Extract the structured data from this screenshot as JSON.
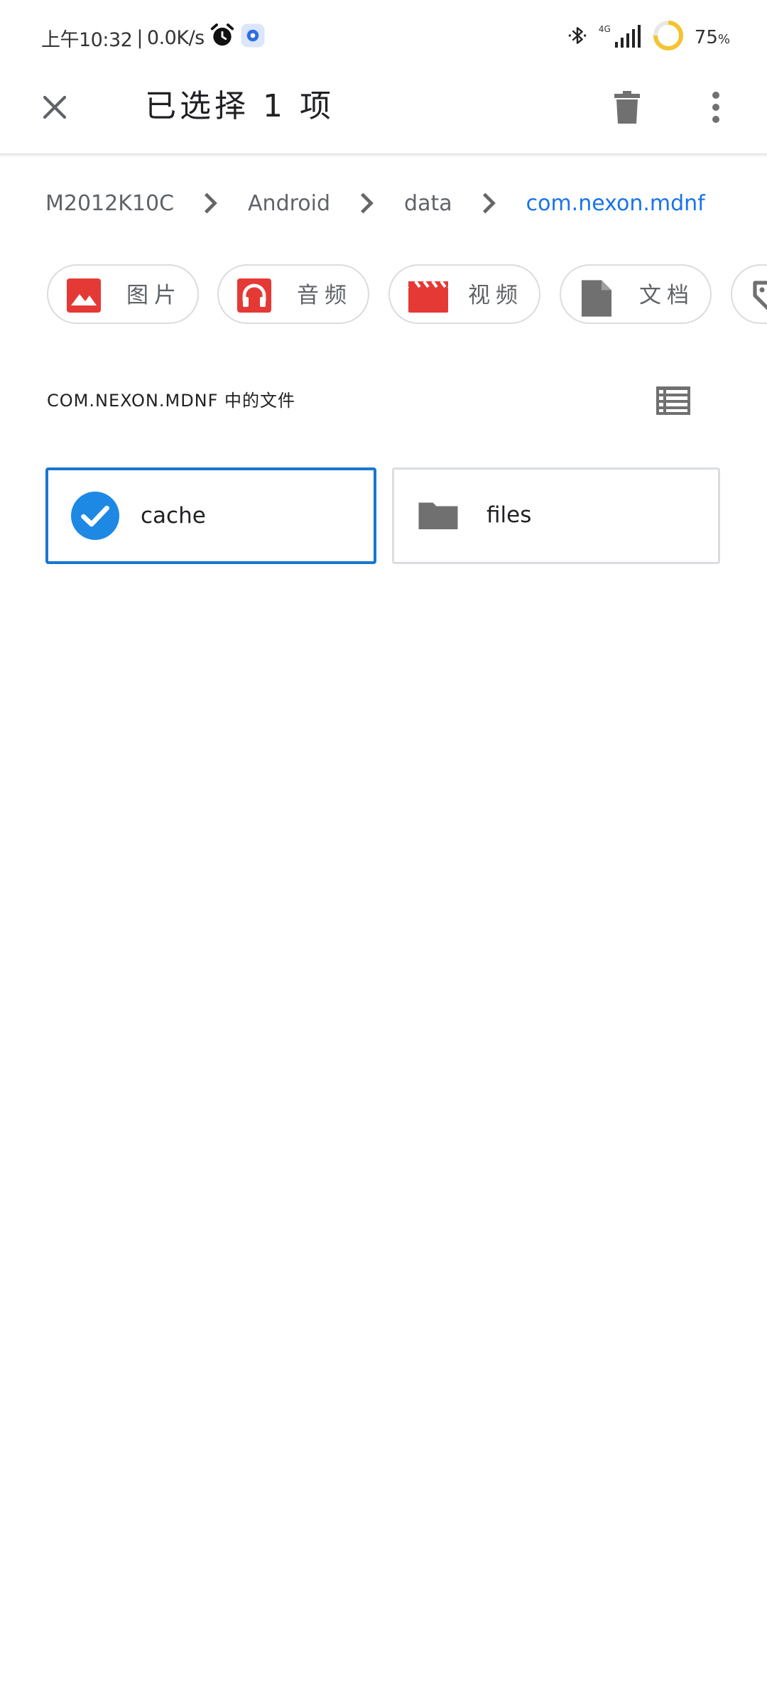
{
  "status_bar": {
    "time": "上午10:32",
    "separator": "|",
    "net_speed": "0.0K/s",
    "network_type": "4G",
    "battery_percent": "75",
    "battery_unit": "%",
    "battery_level": 0.75,
    "battery_ring_color": "#f4c430"
  },
  "app_bar": {
    "title": "已选择 1 项",
    "close_icon": "close-icon",
    "delete_icon": "trash-icon",
    "more_icon": "more-vertical-icon"
  },
  "breadcrumb": {
    "items": [
      "M2012K10C",
      "Android",
      "data",
      "com.nexon.mdnf"
    ],
    "active_color": "#1a73e8"
  },
  "chips": [
    {
      "label": "图片",
      "icon": "image-icon",
      "color": "#e53935"
    },
    {
      "label": "音频",
      "icon": "headphones-icon",
      "color": "#e53935"
    },
    {
      "label": "视频",
      "icon": "movie-icon",
      "color": "#e53935"
    },
    {
      "label": "文档",
      "icon": "document-icon",
      "color": "#757575"
    },
    {
      "label": "",
      "icon": "tag-icon",
      "color": "#757575"
    }
  ],
  "section": {
    "title": "COM.NEXON.MDNF 中的文件",
    "view_toggle_icon": "list-view-icon"
  },
  "files": [
    {
      "name": "cache",
      "selected": true,
      "icon": "check-circle-icon"
    },
    {
      "name": "files",
      "selected": false,
      "icon": "folder-icon"
    }
  ],
  "colors": {
    "selection": "#1976d2",
    "folder": "#707070",
    "icon_gray": "#707070"
  }
}
